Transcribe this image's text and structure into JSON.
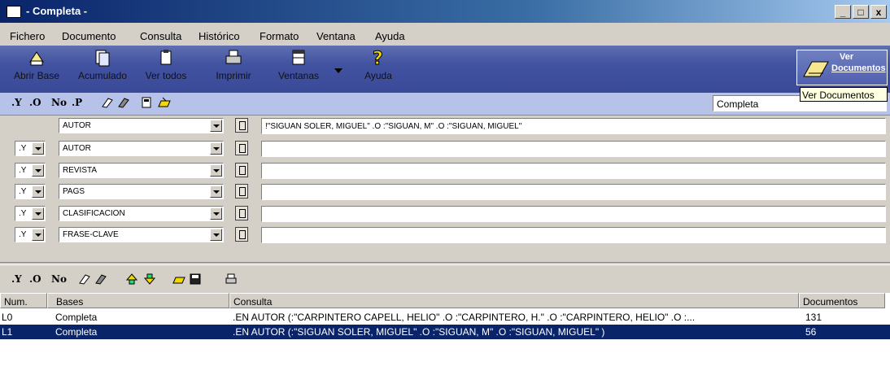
{
  "window": {
    "title": "- Completa -",
    "min": "_",
    "max": "□",
    "close": "x"
  },
  "menu": [
    "Fichero",
    "Documento",
    "Consulta",
    "Histórico",
    "Formato",
    "Ventana",
    "Ayuda"
  ],
  "toolbar": {
    "abrir": "Abrir Base",
    "acumulado": "Acumulado",
    "vertodos": "Ver todos",
    "imprimir": "Imprimir",
    "ventanas": "Ventanas",
    "ayuda": "Ayuda",
    "ver_line1": "Ver",
    "ver_line2": "Documentos",
    "tooltip": "Ver Documentos"
  },
  "ops": {
    "y": ".Y",
    "o": ".O",
    "no": "No",
    "p": ".P"
  },
  "base_select": "Completa",
  "query_rows": [
    {
      "op": "",
      "field": "AUTOR",
      "value": "!\"SIGUAN SOLER, MIGUEL\"  .O :\"SIGUAN, M\"  .O :\"SIGUAN, MIGUEL\""
    },
    {
      "op": ".Y",
      "field": "AUTOR",
      "value": ""
    },
    {
      "op": ".Y",
      "field": "REVISTA",
      "value": ""
    },
    {
      "op": ".Y",
      "field": "PAGS",
      "value": ""
    },
    {
      "op": ".Y",
      "field": "CLASIFICACION",
      "value": ""
    },
    {
      "op": ".Y",
      "field": "FRASE-CLAVE",
      "value": ""
    }
  ],
  "list": {
    "headers": [
      "Num.",
      "Bases",
      "Consulta",
      "Documentos"
    ],
    "rows": [
      {
        "num": "L0",
        "base": "Completa",
        "consulta": ".EN AUTOR (:\"CARPINTERO CAPELL, HELIO\"  .O :\"CARPINTERO, H.\"  .O :\"CARPINTERO, HELIO\"  .O :...",
        "docs": "131"
      },
      {
        "num": "L1",
        "base": "Completa",
        "consulta": ".EN AUTOR (:\"SIGUAN SOLER, MIGUEL\"  .O :\"SIGUAN, M\"  .O :\"SIGUAN, MIGUEL\" )",
        "docs": "56"
      }
    ]
  },
  "colors": {
    "title_start": "#0a246a",
    "toolbar_bg": "#4152a0",
    "selection": "#0a246a"
  }
}
